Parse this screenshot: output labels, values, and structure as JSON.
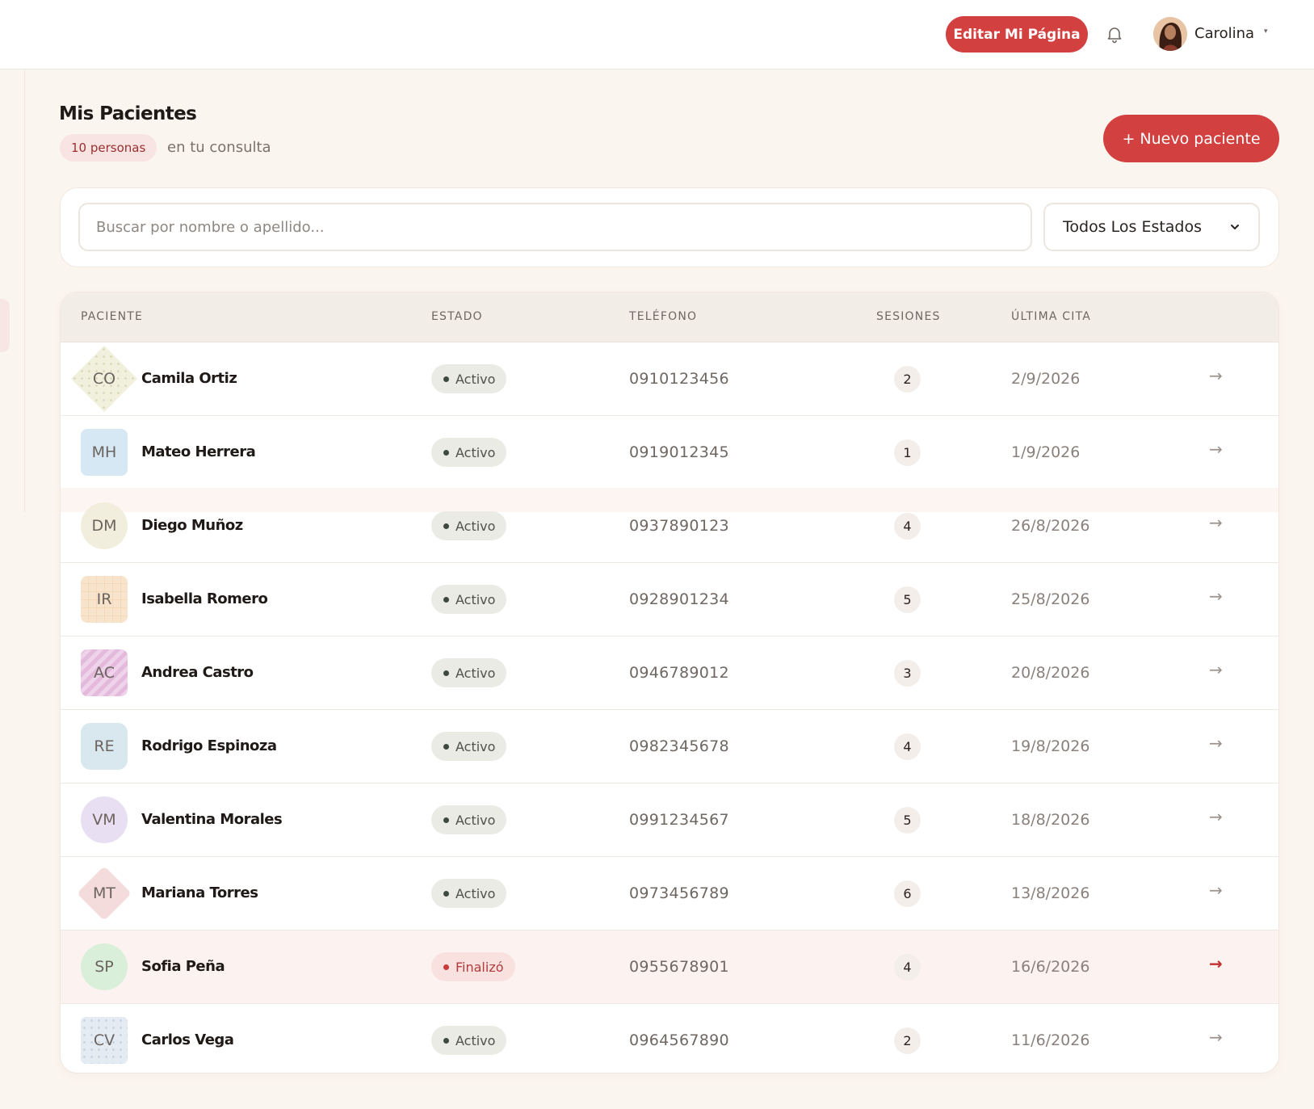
{
  "header": {
    "edit_button": "Editar Mi Página",
    "notification_icon": "bell-icon",
    "user_name": "Carolina",
    "user_caret": "▾"
  },
  "page": {
    "title": "Mis Pacientes",
    "count_badge": "10 personas",
    "count_subtitle": "en tu consulta",
    "new_button": "+ Nuevo paciente"
  },
  "filters": {
    "search_placeholder": "Buscar por nombre o apellido...",
    "search_value": "",
    "status_selected": "Todos Los Estados"
  },
  "table": {
    "headers": {
      "patient": "PACIENTE",
      "status": "ESTADO",
      "phone": "TELÉFONO",
      "sessions": "SESIONES",
      "last": "ÚLTIMA CITA"
    },
    "rows": [
      {
        "initials": "CO",
        "name": "Camila Ortiz",
        "status": "Activo",
        "phone": "0910123456",
        "sessions": "2",
        "last": "2/9/2026",
        "arrow": "→"
      },
      {
        "initials": "MH",
        "name": "Mateo Herrera",
        "status": "Activo",
        "phone": "0919012345",
        "sessions": "1",
        "last": "1/9/2026",
        "arrow": "→"
      },
      {
        "initials": "DM",
        "name": "Diego Muñoz",
        "status": "Activo",
        "phone": "0937890123",
        "sessions": "4",
        "last": "26/8/2026",
        "arrow": "→"
      },
      {
        "initials": "IR",
        "name": "Isabella Romero",
        "status": "Activo",
        "phone": "0928901234",
        "sessions": "5",
        "last": "25/8/2026",
        "arrow": "→"
      },
      {
        "initials": "AC",
        "name": "Andrea Castro",
        "status": "Activo",
        "phone": "0946789012",
        "sessions": "3",
        "last": "20/8/2026",
        "arrow": "→"
      },
      {
        "initials": "RE",
        "name": "Rodrigo Espinoza",
        "status": "Activo",
        "phone": "0982345678",
        "sessions": "4",
        "last": "19/8/2026",
        "arrow": "→"
      },
      {
        "initials": "VM",
        "name": "Valentina Morales",
        "status": "Activo",
        "phone": "0991234567",
        "sessions": "5",
        "last": "18/8/2026",
        "arrow": "→"
      },
      {
        "initials": "MT",
        "name": "Mariana Torres",
        "status": "Activo",
        "phone": "0973456789",
        "sessions": "6",
        "last": "13/8/2026",
        "arrow": "→"
      },
      {
        "initials": "SP",
        "name": "Sofia Peña",
        "status": "Finalizó",
        "phone": "0955678901",
        "sessions": "4",
        "last": "16/6/2026",
        "arrow": "→"
      },
      {
        "initials": "CV",
        "name": "Carlos Vega",
        "status": "Activo",
        "phone": "0964567890",
        "sessions": "2",
        "last": "11/6/2026",
        "arrow": "→"
      }
    ]
  },
  "colors": {
    "accent": "#d2403f",
    "background": "#fbf5ef",
    "active_pill": "#ebebe6",
    "finished_pill": "#f8e1df"
  }
}
